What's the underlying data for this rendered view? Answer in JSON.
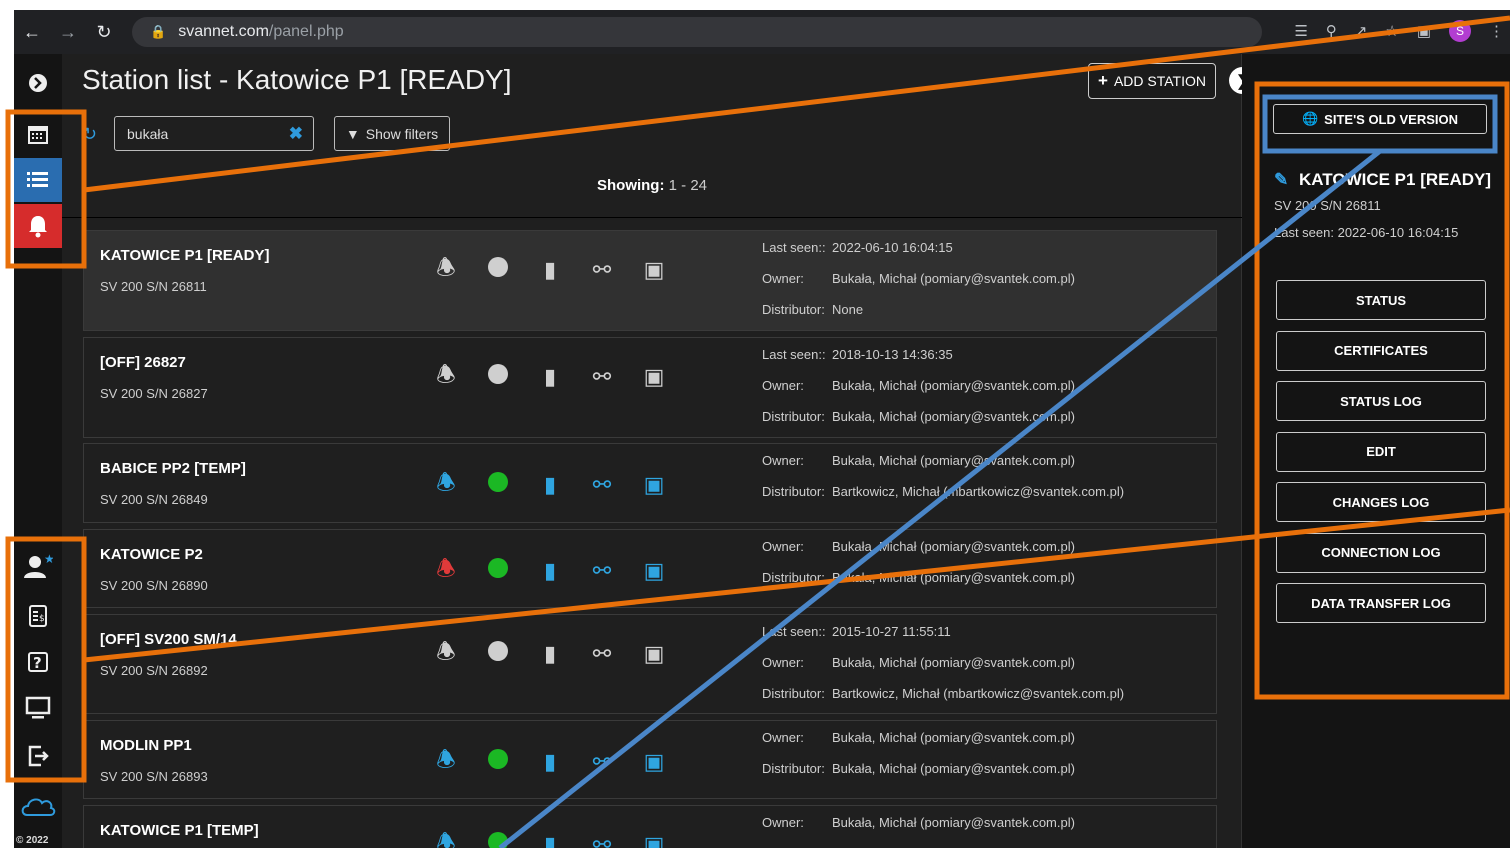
{
  "browser": {
    "url_host": "svannet.com",
    "url_path": "/panel.php",
    "avatar_letter": "S"
  },
  "header": {
    "title": "Station list - Katowice P1 [READY]",
    "add_station_label": "ADD STATION"
  },
  "toolbar": {
    "search_value": "bukała",
    "show_filters_label": "Show filters"
  },
  "showing": {
    "label": "Showing:",
    "range": "1 - 24"
  },
  "stations": [
    {
      "name": "KATOWICE P1 [READY]",
      "sn": "SV 200 S/N 26811",
      "online": false,
      "alert": false,
      "selected": true,
      "info": [
        [
          "Last seen::",
          "2022-06-10 16:04:15"
        ],
        [
          "Owner:",
          "Bukała, Michał (pomiary@svantek.com.pl)"
        ],
        [
          "Distributor:",
          "None"
        ]
      ]
    },
    {
      "name": "[OFF] 26827",
      "sn": "SV 200 S/N 26827",
      "online": false,
      "alert": false,
      "selected": false,
      "info": [
        [
          "Last seen::",
          "2018-10-13 14:36:35"
        ],
        [
          "Owner:",
          "Bukała, Michał (pomiary@svantek.com.pl)"
        ],
        [
          "Distributor:",
          "Bukała, Michał (pomiary@svantek.com.pl)"
        ]
      ]
    },
    {
      "name": "BABICE PP2 [TEMP]",
      "sn": "SV 200 S/N 26849",
      "online": true,
      "alert": false,
      "selected": false,
      "info": [
        [
          "Owner:",
          "Bukała, Michał (pomiary@svantek.com.pl)"
        ],
        [
          "Distributor:",
          "Bartkowicz, Michał (mbartkowicz@svantek.com.pl)"
        ]
      ]
    },
    {
      "name": "KATOWICE P2",
      "sn": "SV 200 S/N 26890",
      "online": true,
      "alert": true,
      "selected": false,
      "info": [
        [
          "Owner:",
          "Bukała, Michał (pomiary@svantek.com.pl)"
        ],
        [
          "Distributor:",
          "Bukała, Michał (pomiary@svantek.com.pl)"
        ]
      ]
    },
    {
      "name": "[OFF] SV200 SM/14",
      "sn": "SV 200 S/N 26892",
      "online": false,
      "alert": false,
      "selected": false,
      "info": [
        [
          "Last seen::",
          "2015-10-27 11:55:11"
        ],
        [
          "Owner:",
          "Bukała, Michał (pomiary@svantek.com.pl)"
        ],
        [
          "Distributor:",
          "Bartkowicz, Michał (mbartkowicz@svantek.com.pl)"
        ]
      ]
    },
    {
      "name": "MODLIN PP1",
      "sn": "SV 200 S/N 26893",
      "online": true,
      "alert": false,
      "selected": false,
      "info": [
        [
          "Owner:",
          "Bukała, Michał (pomiary@svantek.com.pl)"
        ],
        [
          "Distributor:",
          "Bukała, Michał (pomiary@svantek.com.pl)"
        ]
      ]
    },
    {
      "name": "KATOWICE P1 [TEMP]",
      "sn": "",
      "online": true,
      "alert": false,
      "selected": false,
      "info": [
        [
          "Owner:",
          "Bukała, Michał (pomiary@svantek.com.pl)"
        ]
      ]
    }
  ],
  "panel": {
    "old_version_label": "SITE'S OLD VERSION",
    "station_name": "KATOWICE P1 [READY]",
    "station_sn": "SV 200 S/N 26811",
    "last_seen": "Last seen: 2022-06-10 16:04:15",
    "actions": [
      "STATUS",
      "CERTIFICATES",
      "STATUS LOG",
      "EDIT",
      "CHANGES LOG",
      "CONNECTION LOG",
      "DATA TRANSFER LOG"
    ]
  },
  "footer": {
    "copyright": "© 2022"
  },
  "colors": {
    "accent_blue": "#2f9bdd",
    "online_green": "#1bb824",
    "alert_red": "#d62c2c",
    "annotation_orange": "#e8700a",
    "annotation_blue": "#4a86c8"
  }
}
